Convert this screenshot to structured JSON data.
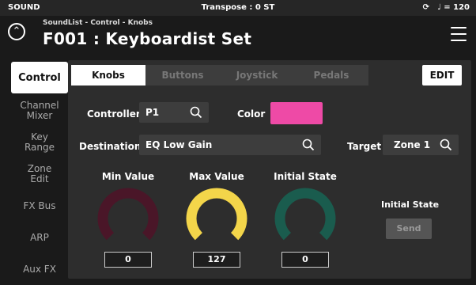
{
  "status": {
    "left": "SOUND",
    "center": "Transpose : 0 ST",
    "tempo": "♩ = 120"
  },
  "header": {
    "breadcrumb": "SoundList - Control - Knobs",
    "title": "F001 : Keyboardist Set"
  },
  "sidebar": {
    "items": [
      {
        "label": "Control",
        "active": true
      },
      {
        "label": "Channel Mixer"
      },
      {
        "label": "Key Range"
      },
      {
        "label": "Zone Edit"
      },
      {
        "label": "FX Bus"
      },
      {
        "label": "ARP"
      },
      {
        "label": "Aux FX"
      }
    ]
  },
  "tabs": [
    "Knobs",
    "Buttons",
    "Joystick",
    "Pedals"
  ],
  "edit_label": "EDIT",
  "form": {
    "controller_label": "Controller",
    "controller_value": "P1",
    "color_label": "Color",
    "color_value": "#ee4aa6",
    "destination_label": "Destination",
    "destination_value": "EQ Low Gain",
    "target_label": "Target",
    "target_value": "Zone 1"
  },
  "knobs": [
    {
      "title": "Min Value",
      "value": "0",
      "color": "#4a1628",
      "level": 0
    },
    {
      "title": "Max Value",
      "value": "127",
      "color": "#f3d54a",
      "level": 1
    },
    {
      "title": "Initial State",
      "value": "0",
      "color": "#1a5c4e",
      "level": 0
    }
  ],
  "initial_state": {
    "label": "Initial State",
    "send_label": "Send"
  }
}
